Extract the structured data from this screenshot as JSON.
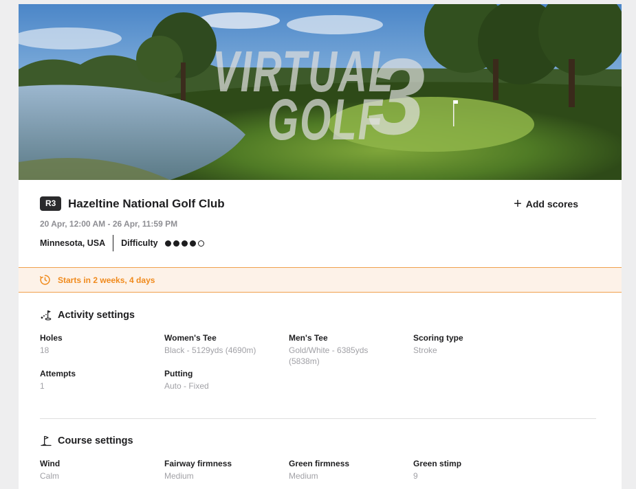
{
  "hero": {
    "logo_line1": "VIRTUAL",
    "logo_line2": "GOLF",
    "logo_number": "3"
  },
  "event": {
    "round_badge": "R3",
    "course_name": "Hazeltine National Golf Club",
    "date_range": "20 Apr, 12:00 AM - 26 Apr, 11:59 PM",
    "location": "Minnesota, USA",
    "difficulty_label": "Difficulty",
    "difficulty_level": 4,
    "difficulty_max": 5,
    "add_scores_label": "Add scores"
  },
  "banner": {
    "text": "Starts in 2 weeks, 4 days",
    "color": "#f08a1c"
  },
  "activity_settings": {
    "title": "Activity settings",
    "items": [
      {
        "label": "Holes",
        "value": "18"
      },
      {
        "label": "Women's Tee",
        "value": "Black - 5129yds (4690m)"
      },
      {
        "label": "Men's Tee",
        "value": "Gold/White - 6385yds (5838m)"
      },
      {
        "label": "Scoring type",
        "value": "Stroke"
      },
      {
        "label": "Attempts",
        "value": "1"
      },
      {
        "label": "Putting",
        "value": "Auto - Fixed"
      }
    ]
  },
  "course_settings": {
    "title": "Course settings",
    "items": [
      {
        "label": "Wind",
        "value": "Calm"
      },
      {
        "label": "Fairway firmness",
        "value": "Medium"
      },
      {
        "label": "Green firmness",
        "value": "Medium"
      },
      {
        "label": "Green stimp",
        "value": "9"
      }
    ]
  },
  "icons": {
    "add": "plus-icon",
    "timer": "timer-icon",
    "activity": "golf-activity-icon",
    "course": "flag-icon"
  }
}
